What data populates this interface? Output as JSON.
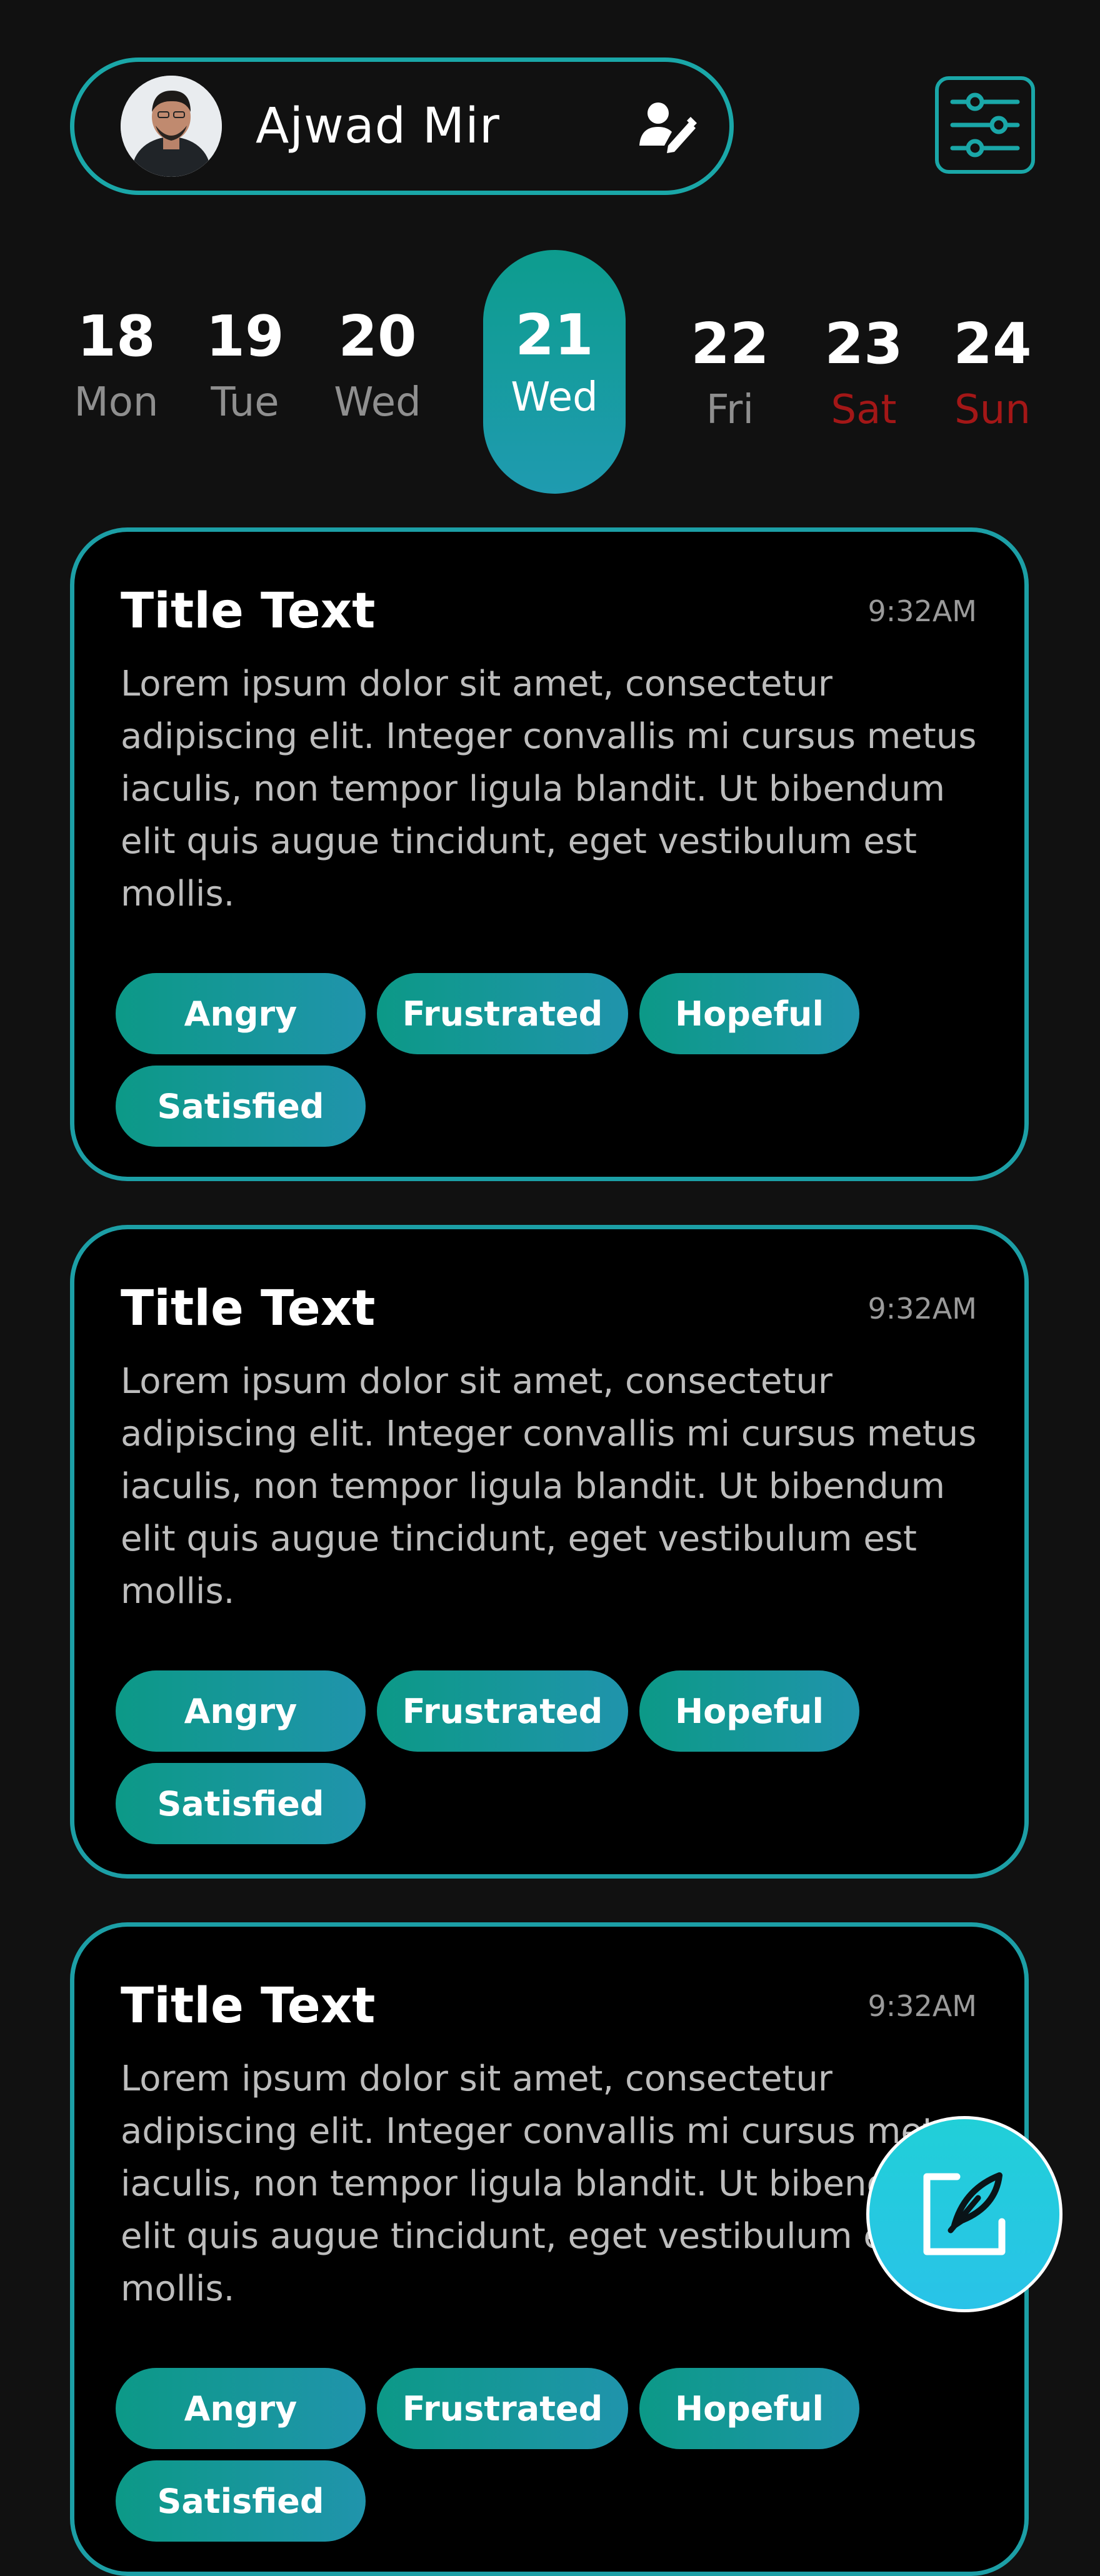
{
  "header": {
    "user_name": "Ajwad Mir",
    "avatar_icon": "user-photo",
    "edit_icon": "user-edit-icon",
    "filter_icon": "sliders-icon"
  },
  "dates": [
    {
      "num": "18",
      "dow": "Mon"
    },
    {
      "num": "19",
      "dow": "Tue"
    },
    {
      "num": "20",
      "dow": "Wed"
    },
    {
      "num": "21",
      "dow": "Wed",
      "selected": true
    },
    {
      "num": "22",
      "dow": "Fri"
    },
    {
      "num": "23",
      "dow": "Sat",
      "weekend": true
    },
    {
      "num": "24",
      "dow": "Sun",
      "weekend": true
    }
  ],
  "entries": [
    {
      "title": "Title Text",
      "time": "9:32AM",
      "body": "Lorem ipsum dolor sit amet, consectetur adipiscing elit. Integer convallis mi cursus metus iaculis, non tempor ligula blandit. Ut bibendum elit quis augue tincidunt, eget vestibulum est mollis.",
      "tags": [
        "Angry",
        "Frustrated",
        "Hopeful",
        "Satisfied"
      ]
    },
    {
      "title": "Title Text",
      "time": "9:32AM",
      "body": "Lorem ipsum dolor sit amet, consectetur adipiscing elit. Integer convallis mi cursus metus iaculis, non tempor ligula blandit. Ut bibendum elit quis augue tincidunt, eget vestibulum est mollis.",
      "tags": [
        "Angry",
        "Frustrated",
        "Hopeful",
        "Satisfied"
      ]
    },
    {
      "title": "Title Text",
      "time": "9:32AM",
      "body": "Lorem ipsum dolor sit amet, consectetur adipiscing elit. Integer convallis mi cursus metus iaculis, non tempor ligula blandit. Ut bibendum elit quis augue tincidunt, eget vestibulum est mollis.",
      "tags": [
        "Angry",
        "Frustrated",
        "Hopeful",
        "Satisfied"
      ]
    }
  ],
  "fab": {
    "icon": "new-note-icon"
  },
  "colors": {
    "background": "#111111",
    "accent": "#1aa7a8",
    "weekend": "#a31717",
    "fab": "#22cbe0"
  }
}
